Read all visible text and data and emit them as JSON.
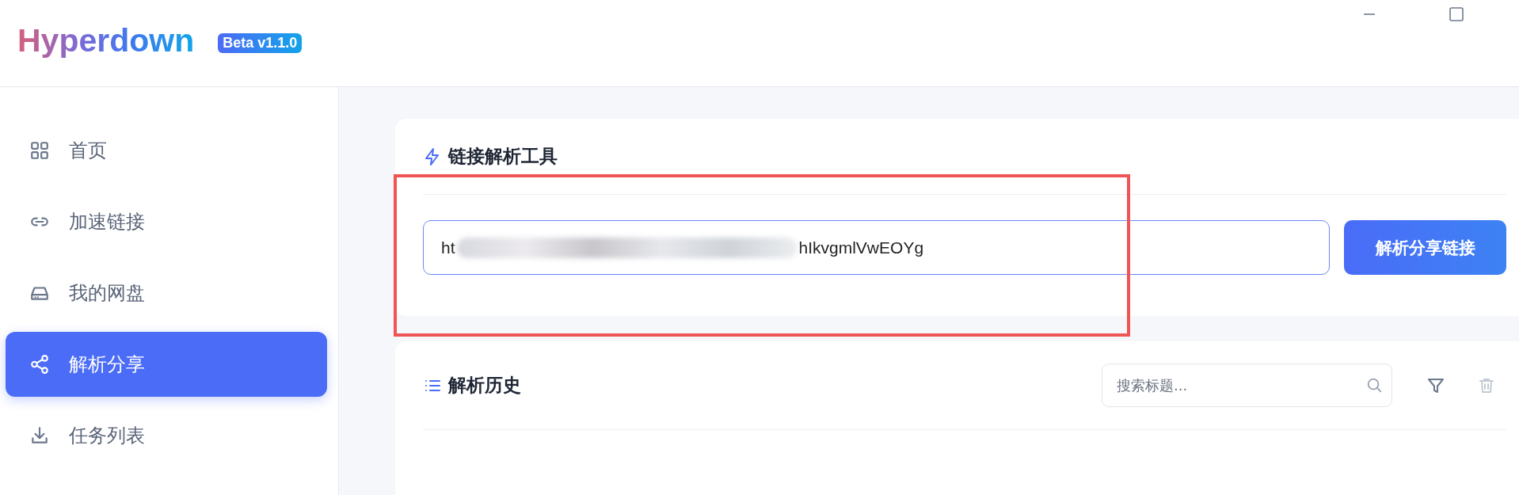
{
  "header": {
    "logo": "Hyperdown",
    "badge": "Beta v1.1.0",
    "window_controls": [
      {
        "kind": "minimize"
      },
      {
        "kind": "maximize"
      }
    ]
  },
  "sidebar": {
    "items": [
      {
        "label": "首页",
        "kind": "grid",
        "selected": false
      },
      {
        "label": "加速链接",
        "kind": "link",
        "selected": false
      },
      {
        "label": "我的网盘",
        "kind": "drive",
        "selected": false
      },
      {
        "label": "解析分享",
        "kind": "share",
        "selected": true
      },
      {
        "label": "任务列表",
        "kind": "download",
        "selected": false
      }
    ]
  },
  "parse_tool": {
    "title": "链接解析工具",
    "url_field": {
      "value_start": "ht",
      "redacted": true,
      "value_end": "hIkvgmlVwEOYg"
    },
    "button": "解析分享链接",
    "highlighted": true
  },
  "history": {
    "title": "解析历史",
    "search": {
      "placeholder": "搜索标题..."
    },
    "actions": [
      {
        "kind": "filter",
        "disabled": false
      },
      {
        "kind": "delete",
        "disabled": true
      }
    ]
  }
}
